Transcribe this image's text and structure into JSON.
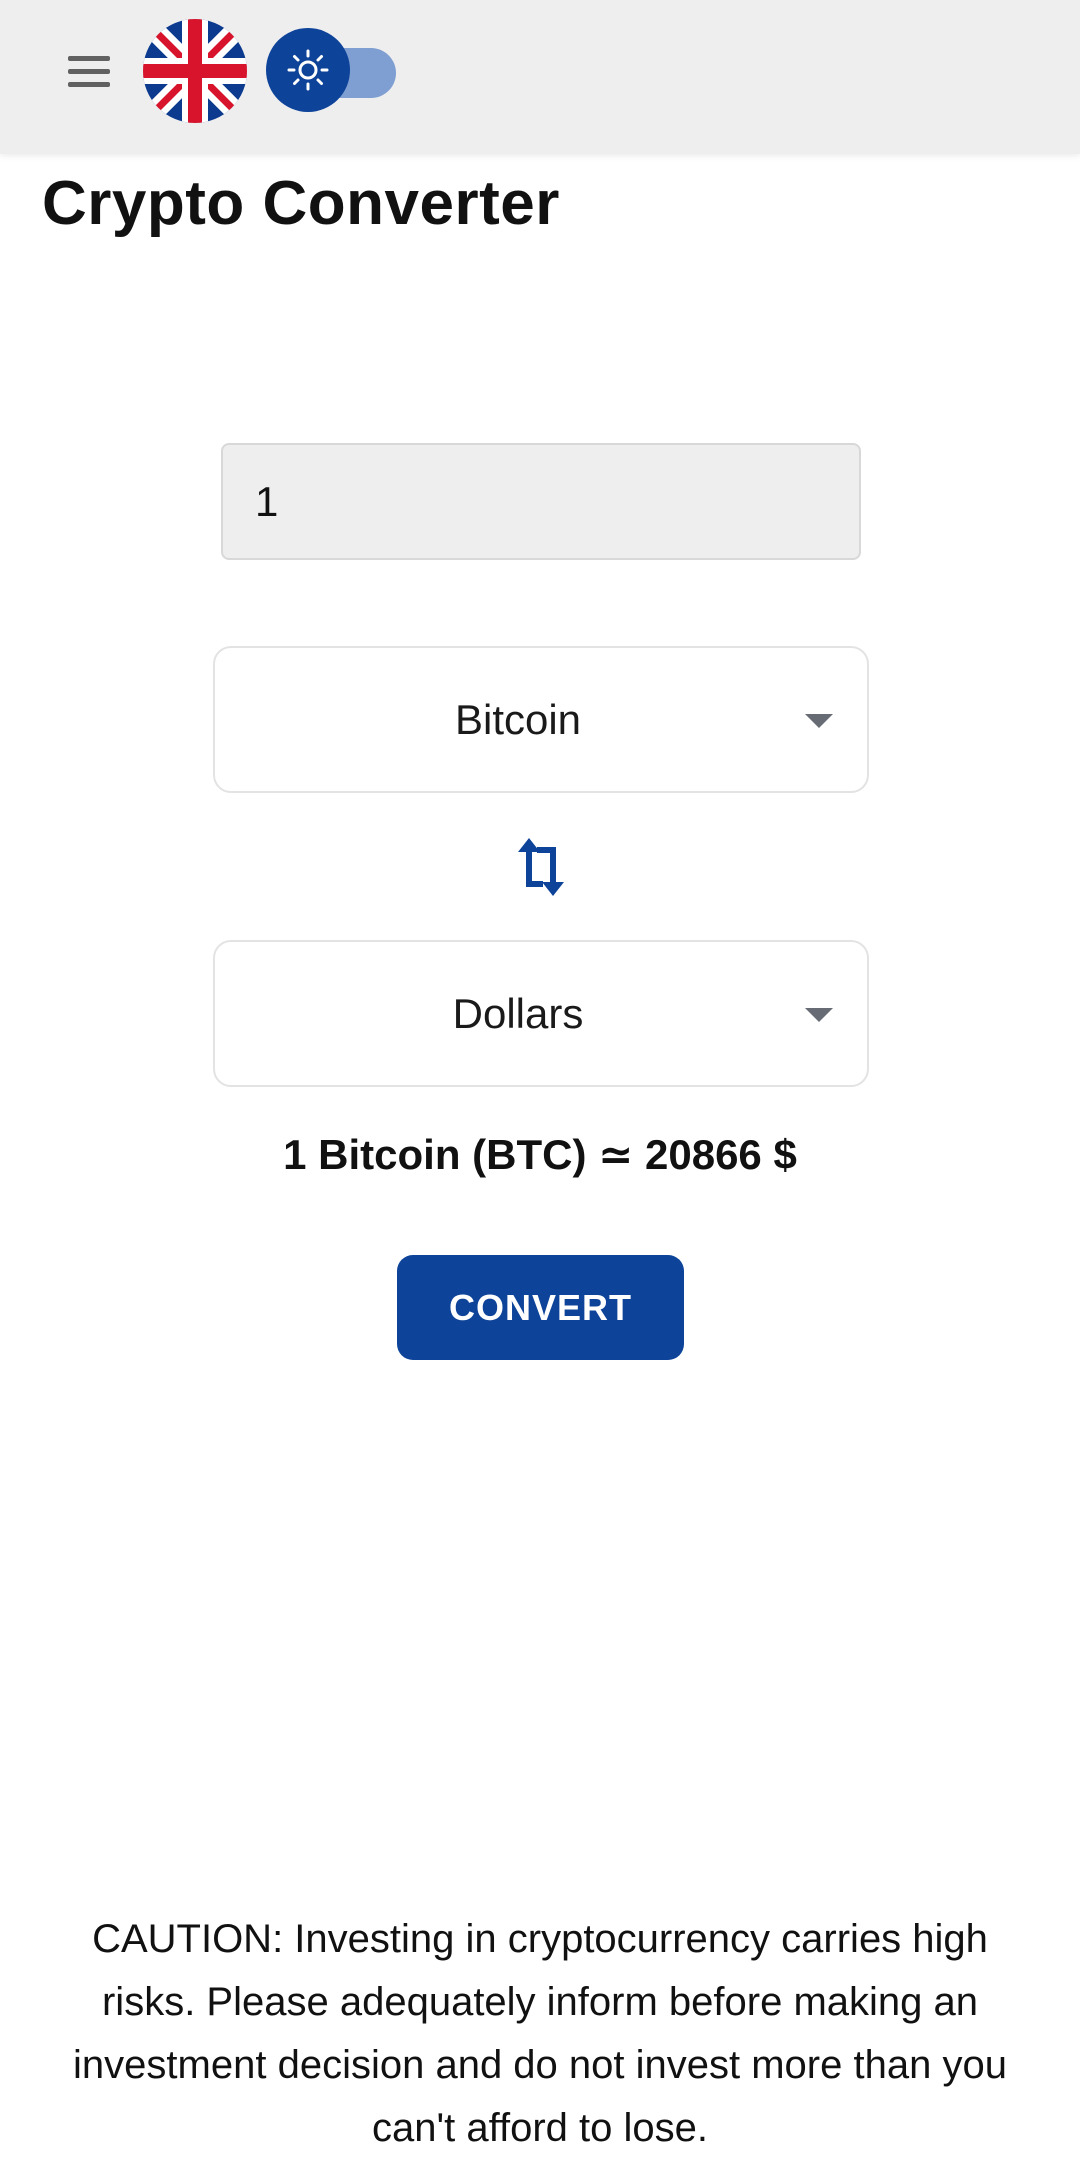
{
  "header": {
    "menu_icon": "hamburger-menu-icon",
    "language_flag_icon": "uk-flag-icon",
    "theme_toggle_icon": "sun-icon",
    "theme_mode": "light",
    "accent_color": "#0d4399",
    "bar_color": "#eeeeef"
  },
  "page": {
    "title": "Crypto Converter"
  },
  "converter": {
    "amount_value": "1",
    "from_currency": "Bitcoin",
    "to_currency": "Dollars",
    "swap_icon": "swap-arrows-icon",
    "dropdown_icon": "caret-down-icon",
    "result": "1 Bitcoin (BTC) ≃ 20866 $",
    "convert_label": "CONVERT"
  },
  "footer": {
    "caution": "CAUTION: Investing in cryptocurrency carries high risks. Please adequately inform before making an investment decision and do not invest more than you can't afford to lose."
  }
}
